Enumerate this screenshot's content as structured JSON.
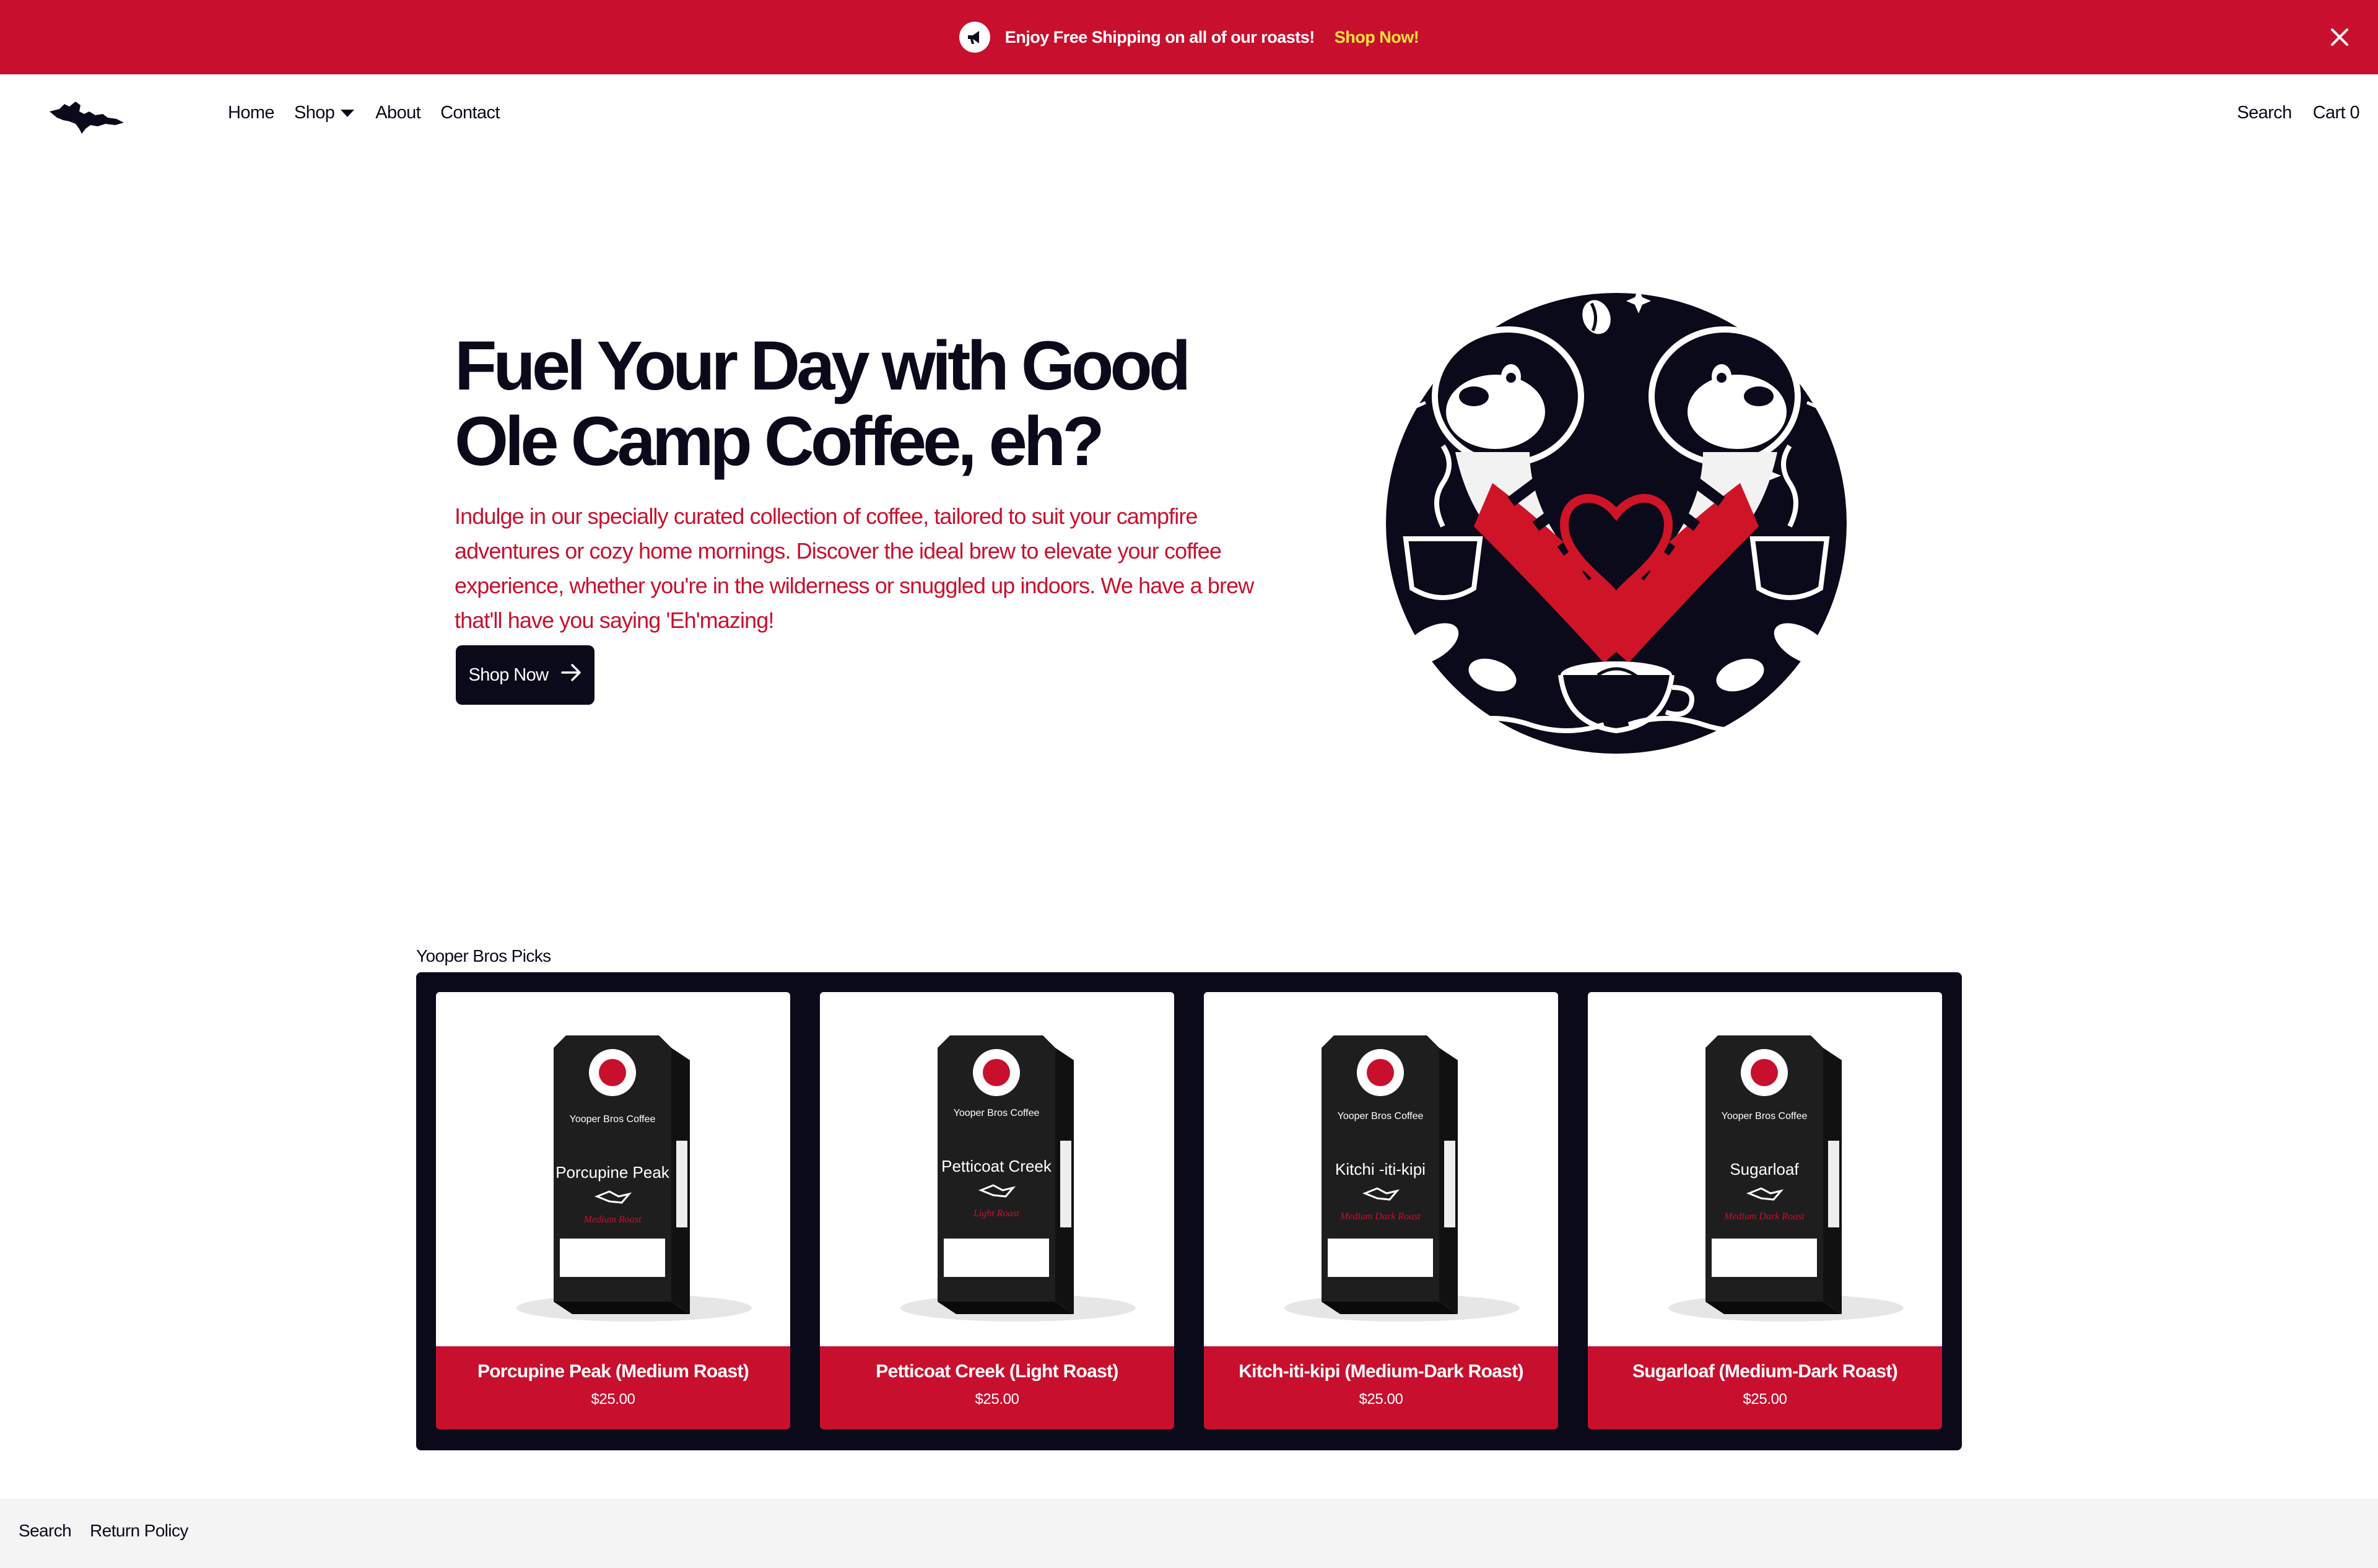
{
  "announcement": {
    "text": "Enjoy Free Shipping on all of our roasts!",
    "link": "Shop Now!",
    "icon": "megaphone-icon"
  },
  "nav": {
    "items": [
      {
        "label": "Home"
      },
      {
        "label": "Shop"
      },
      {
        "label": "About"
      },
      {
        "label": "Contact"
      }
    ],
    "search": "Search",
    "cart": "Cart 0"
  },
  "hero": {
    "title": "Fuel Your Day with Good Ole Camp Coffee, eh?",
    "description": "Indulge in our specially curated collection of coffee, tailored to suit your campfire adventures or cozy home mornings. Discover the ideal brew to elevate your coffee experience, whether you're in the wilderness or snuggled up indoors. We have a brew that'll have you saying 'Eh'mazing!",
    "button": "Shop Now"
  },
  "featured": {
    "title": "Yooper Bros Picks",
    "products": [
      {
        "name": "Porcupine Peak (Medium Roast)",
        "price": "$25.00",
        "bag_brand": "Yooper Bros Coffee",
        "bag_name": "Porcupine Peak",
        "bag_roast": "Medium Roast"
      },
      {
        "name": "Petticoat Creek (Light Roast)",
        "price": "$25.00",
        "bag_brand": "Yooper Bros Coffee",
        "bag_name": "Petticoat Creek",
        "bag_roast": "Light Roast"
      },
      {
        "name": "Kitch-iti-kipi (Medium-Dark Roast)",
        "price": "$25.00",
        "bag_brand": "Yooper Bros Coffee",
        "bag_name": "Kitchi -iti-kipi",
        "bag_roast": "Medium Dark Roast"
      },
      {
        "name": "Sugarloaf (Medium-Dark Roast)",
        "price": "$25.00",
        "bag_brand": "Yooper Bros Coffee",
        "bag_name": "Sugarloaf",
        "bag_roast": "Medium Dark Roast"
      }
    ]
  },
  "footer": {
    "links": [
      {
        "label": "Search"
      },
      {
        "label": "Return Policy"
      }
    ]
  },
  "colors": {
    "brand_red": "#c8102e",
    "navy": "#0b0a1a",
    "accent_yellow": "#ffe23b"
  }
}
